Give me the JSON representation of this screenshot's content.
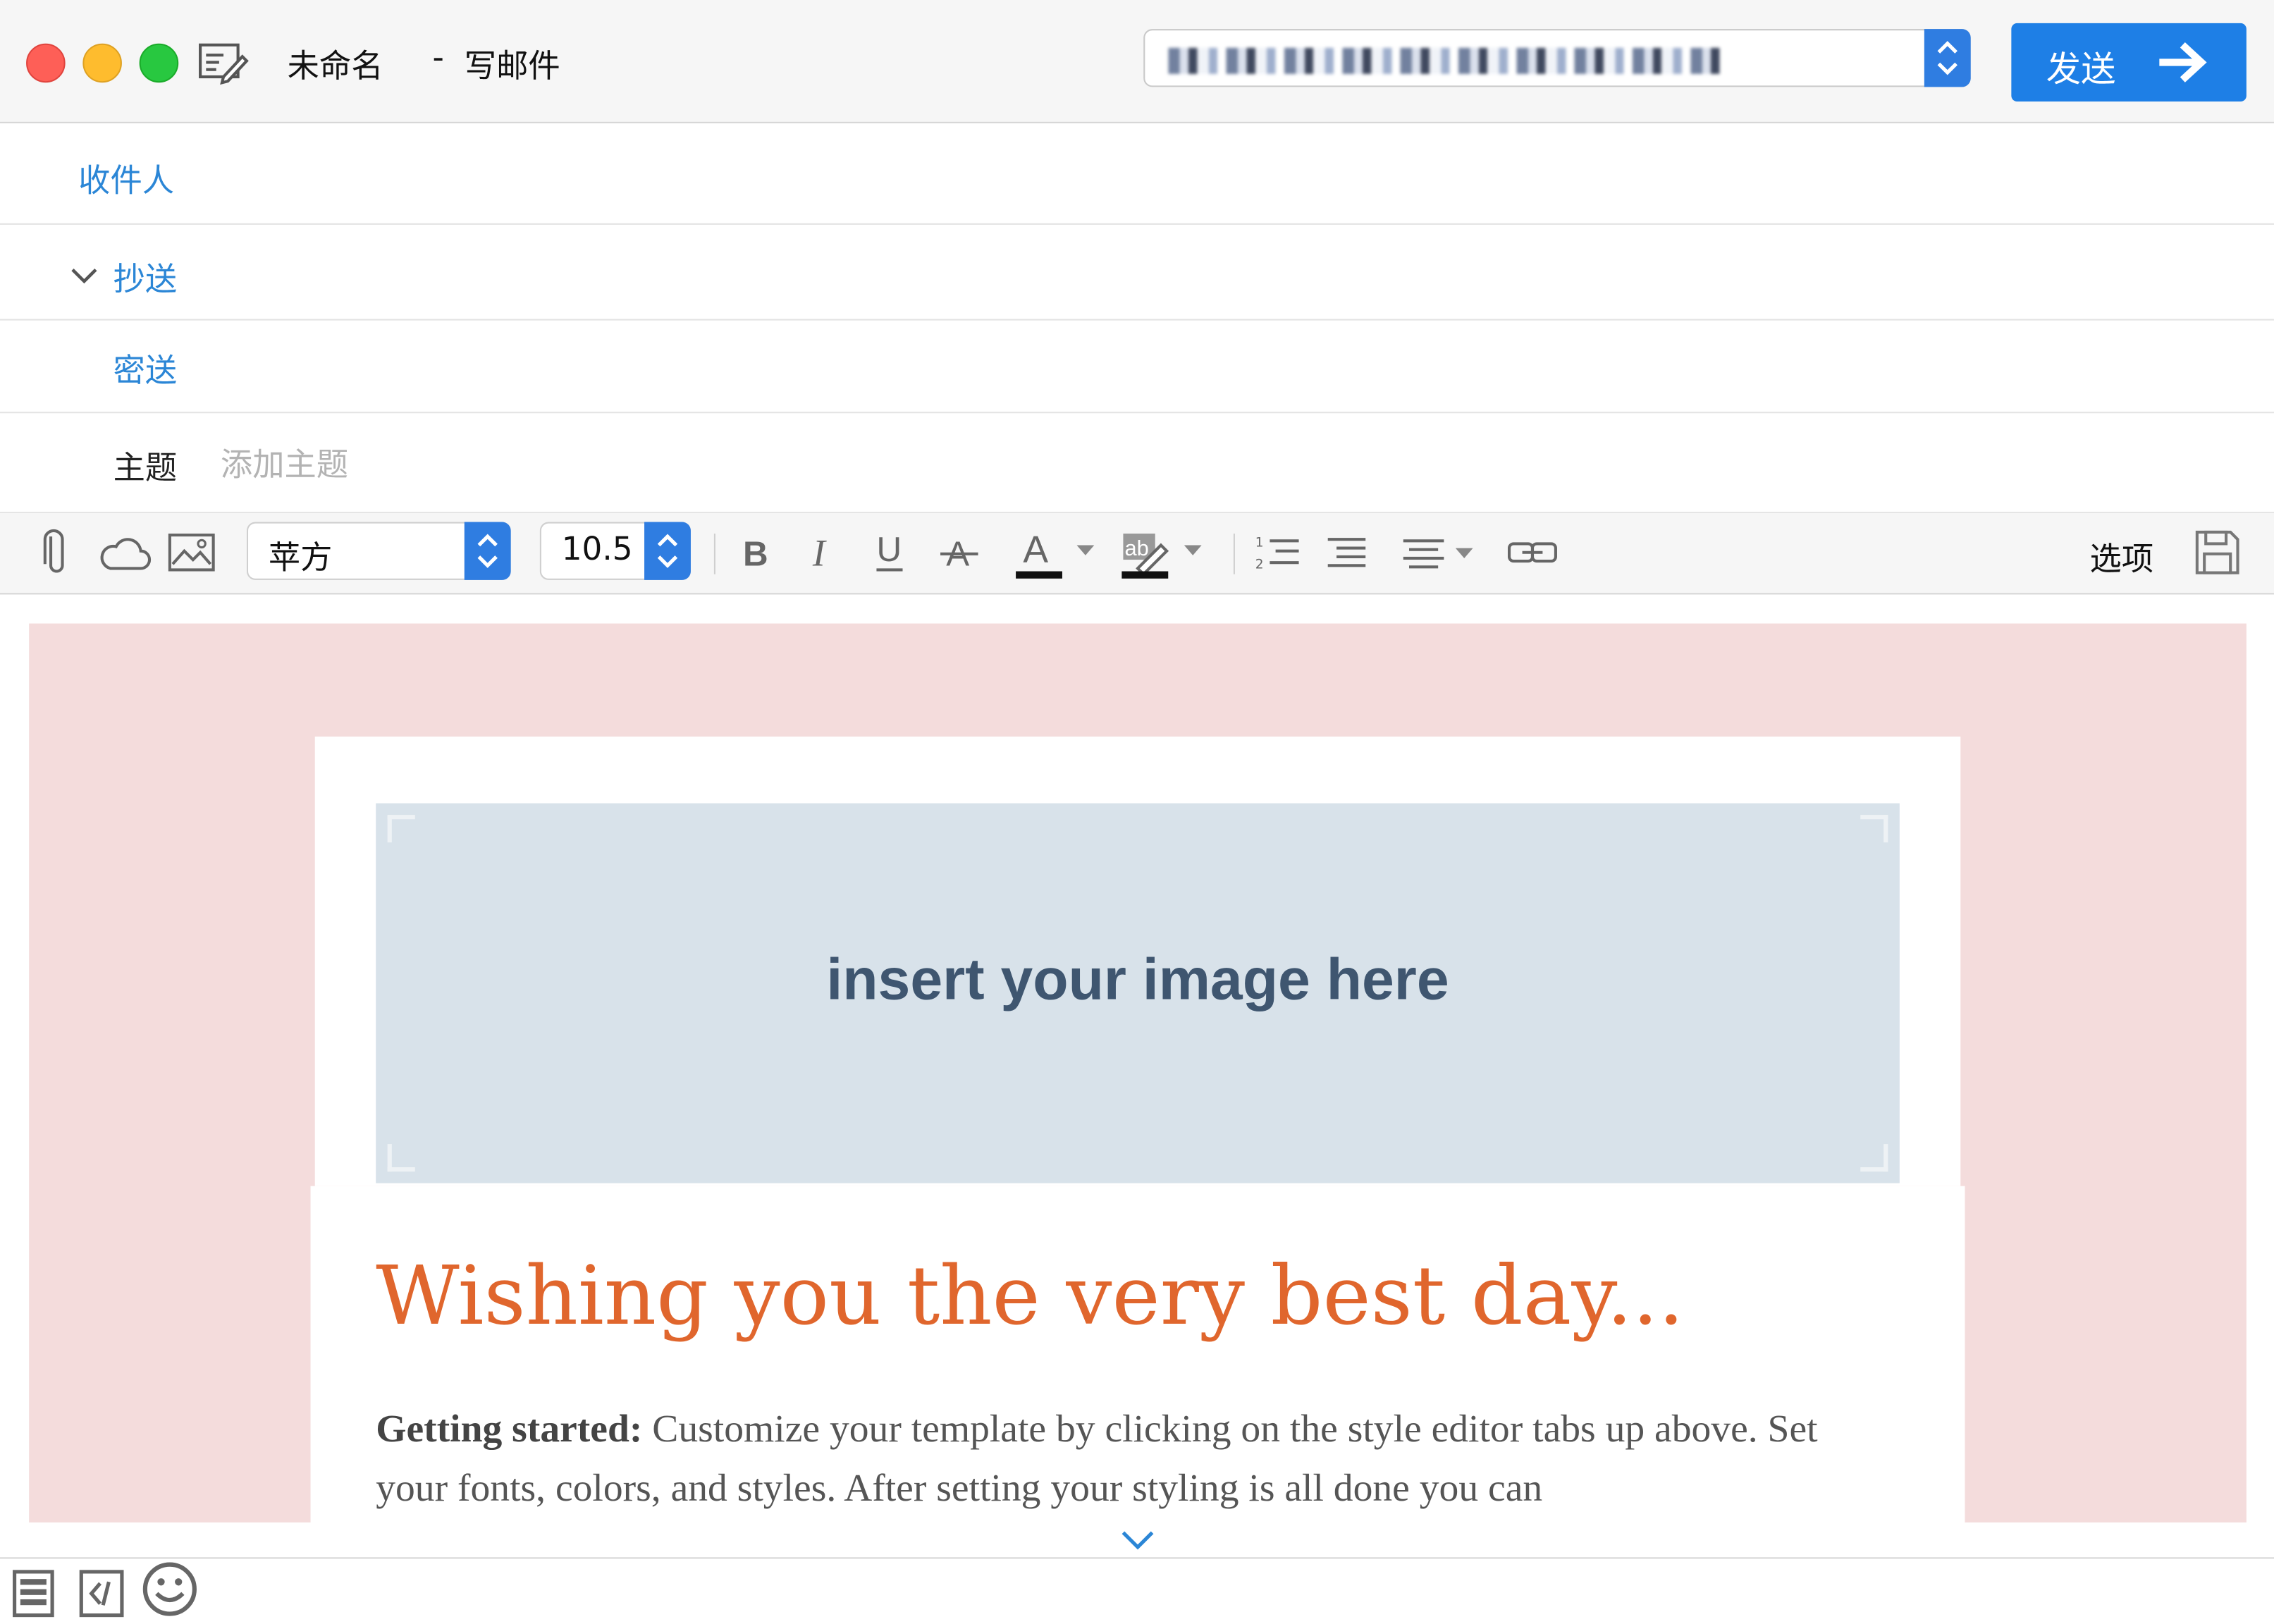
{
  "window": {
    "title": "未命名",
    "separator": "-",
    "mode": "写邮件"
  },
  "send": {
    "label": "发送"
  },
  "fields": {
    "to_label": "收件人",
    "cc_label": "抄送",
    "bcc_label": "密送",
    "subject_label": "主题",
    "subject_placeholder": "添加主题",
    "subject_value": ""
  },
  "toolbar": {
    "font_family": "苹方",
    "font_size": "10.5",
    "options_label": "选项",
    "icons": [
      "paperclip-icon",
      "cloud-icon",
      "image-icon",
      "bold-icon",
      "italic-icon",
      "underline-icon",
      "strikethrough-icon",
      "text-color-icon",
      "highlight-icon",
      "numbered-list-icon",
      "bulleted-list-icon",
      "align-icon",
      "link-icon",
      "save-icon"
    ]
  },
  "content": {
    "image_placeholder": "insert your image here",
    "headline": "Wishing you the very best day...",
    "body_bold": "Getting started:",
    "body_text": " Customize your template by clicking on the style editor tabs up above. Set your fonts, colors, and styles. After setting your styling is all done you can"
  },
  "colors": {
    "accent": "#1e7fe6",
    "link": "#2b86d6",
    "canvas_bg": "#f4dcdc",
    "headline": "#e0662d",
    "placeholder_bg": "#d8e2ea"
  },
  "bottom": {
    "icons": [
      "layout-icon",
      "code-icon",
      "emoji-icon"
    ]
  }
}
